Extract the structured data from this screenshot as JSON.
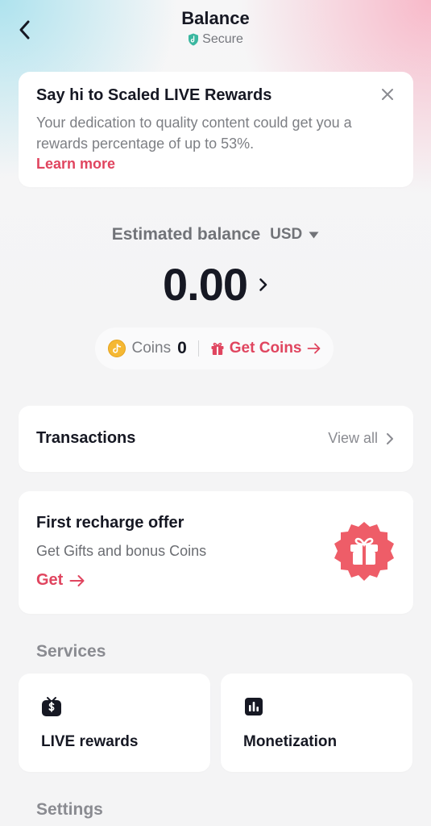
{
  "header": {
    "title": "Balance",
    "secure_label": "Secure",
    "back_icon": "chevron-left-icon",
    "secure_icon": "shield-icon"
  },
  "banner": {
    "title": "Say hi to Scaled LIVE Rewards",
    "body": "Your dedication to quality content could get you a rewards percentage of up to 53%.",
    "link": "Learn more",
    "close_icon": "close-icon"
  },
  "balance": {
    "label": "Estimated balance",
    "currency": "USD",
    "amount": "0.00"
  },
  "coins": {
    "label": "Coins",
    "value": "0",
    "get_label": "Get Coins",
    "coin_icon": "coin-icon",
    "gift_icon": "gift-icon"
  },
  "transactions": {
    "title": "Transactions",
    "view_all": "View all"
  },
  "offer": {
    "title": "First recharge offer",
    "subtitle": "Get Gifts and bonus Coins",
    "cta": "Get",
    "badge_icon": "gift-badge-icon"
  },
  "services": {
    "title": "Services",
    "items": [
      {
        "label": "LIVE rewards",
        "icon": "tv-dollar-icon"
      },
      {
        "label": "Monetization",
        "icon": "bar-chart-icon"
      }
    ]
  },
  "settings": {
    "title": "Settings"
  },
  "colors": {
    "accent": "#e0455f",
    "text_primary": "#161823",
    "text_secondary": "#7d7f84",
    "background": "#f4f4f5",
    "coin": "#f5b833",
    "secure_green": "#3bb7a0"
  }
}
